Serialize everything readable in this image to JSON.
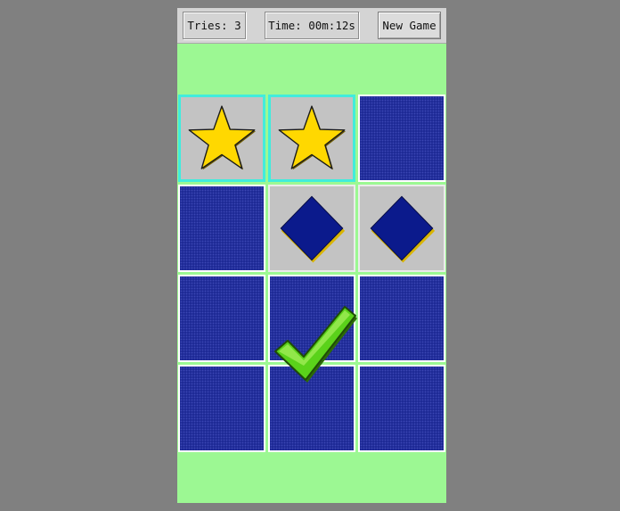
{
  "toolbar": {
    "tries_text": "Tries: 3",
    "time_text": "Time: 00m:12s",
    "new_game_label": "New Game"
  },
  "board": {
    "rows": 4,
    "cols": 3,
    "cards": [
      {
        "row": 0,
        "col": 0,
        "state": "face",
        "symbol": "star-icon",
        "selected": true
      },
      {
        "row": 0,
        "col": 1,
        "state": "face",
        "symbol": "star-icon",
        "selected": true
      },
      {
        "row": 0,
        "col": 2,
        "state": "back"
      },
      {
        "row": 1,
        "col": 0,
        "state": "back"
      },
      {
        "row": 1,
        "col": 1,
        "state": "face",
        "symbol": "diamond-icon",
        "selected": false
      },
      {
        "row": 1,
        "col": 2,
        "state": "face",
        "symbol": "diamond-icon",
        "selected": false
      },
      {
        "row": 2,
        "col": 0,
        "state": "back"
      },
      {
        "row": 2,
        "col": 1,
        "state": "back"
      },
      {
        "row": 2,
        "col": 2,
        "state": "back"
      },
      {
        "row": 3,
        "col": 0,
        "state": "back"
      },
      {
        "row": 3,
        "col": 1,
        "state": "back"
      },
      {
        "row": 3,
        "col": 2,
        "state": "back"
      }
    ],
    "match_indicator": "checkmark-icon"
  },
  "colors": {
    "window_background": "#808080",
    "board_background": "#9cf893",
    "card_back": "#1e2a96",
    "card_face": "#c3c3c3",
    "selected_border": "#41ecdc",
    "star_fill": "#ffd800",
    "diamond_fill": "#0b1a8c",
    "check_fill": "#5ad21a"
  }
}
